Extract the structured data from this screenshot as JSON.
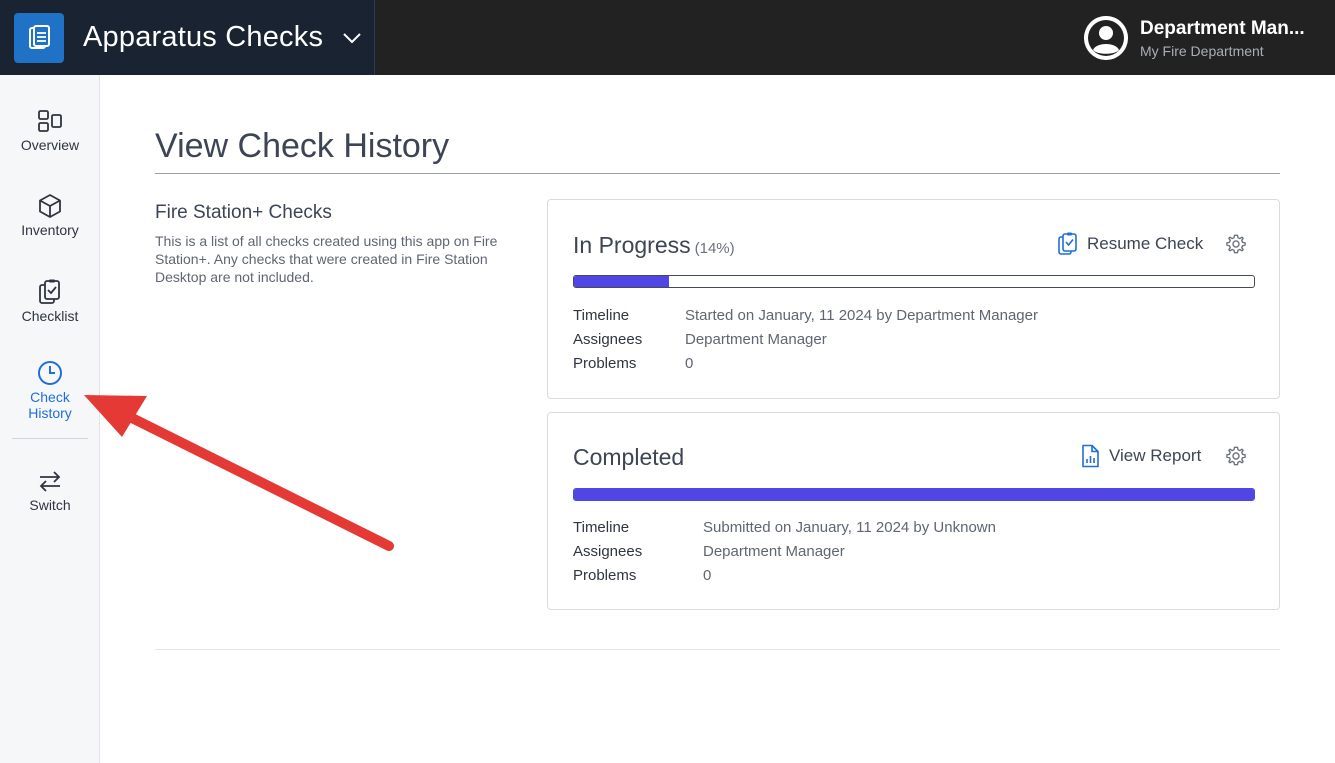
{
  "app": {
    "title": "Apparatus Checks",
    "accent_color": "#1f72c6",
    "logo_icon": "clipboard-list-icon",
    "chevron_icon": "chevron-down-icon"
  },
  "user": {
    "name": "Department Man...",
    "department": "My Fire Department",
    "avatar_icon": "user-circle-icon"
  },
  "sidebar": {
    "items": [
      {
        "label": "Overview",
        "icon": "layout-icon"
      },
      {
        "label": "Inventory",
        "icon": "cube-icon"
      },
      {
        "label": "Checklist",
        "icon": "clipboard-check-icon"
      },
      {
        "label_line1": "Check",
        "label_line2": "History",
        "icon": "clock-icon",
        "active": true
      },
      {
        "label": "Switch",
        "icon": "arrows-swap-icon"
      }
    ],
    "active_color": "#1f6fd9"
  },
  "main": {
    "title": "View Check History",
    "section_title": "Fire Station+ Checks",
    "section_desc": "This is a list of all checks created using this app on Fire Station+. Any checks that were created in Fire Station Desktop are not included.",
    "cards": [
      {
        "status": "In Progress",
        "percent_label": "(14%)",
        "progress": 0.14,
        "action_label": "Resume Check",
        "action_icon": "clipboard-check-icon",
        "settings_icon": "gear-icon",
        "labels": {
          "timeline": "Timeline",
          "assignees": "Assignees",
          "problems": "Problems"
        },
        "timeline": "Started on January, 11 2024 by Department Manager",
        "assignees": "Department Manager",
        "problems": "0"
      },
      {
        "status": "Completed",
        "progress": 1.0,
        "action_label": "View Report",
        "action_icon": "file-chart-icon",
        "settings_icon": "gear-icon",
        "labels": {
          "timeline": "Timeline",
          "assignees": "Assignees",
          "problems": "Problems"
        },
        "timeline": "Submitted on January, 11 2024 by Unknown",
        "assignees": "Department Manager",
        "problems": "0"
      }
    ],
    "progress_color": "#4f46e5"
  },
  "annotation": {
    "arrow_color": "#e53935",
    "icon": "red-arrow-icon"
  }
}
